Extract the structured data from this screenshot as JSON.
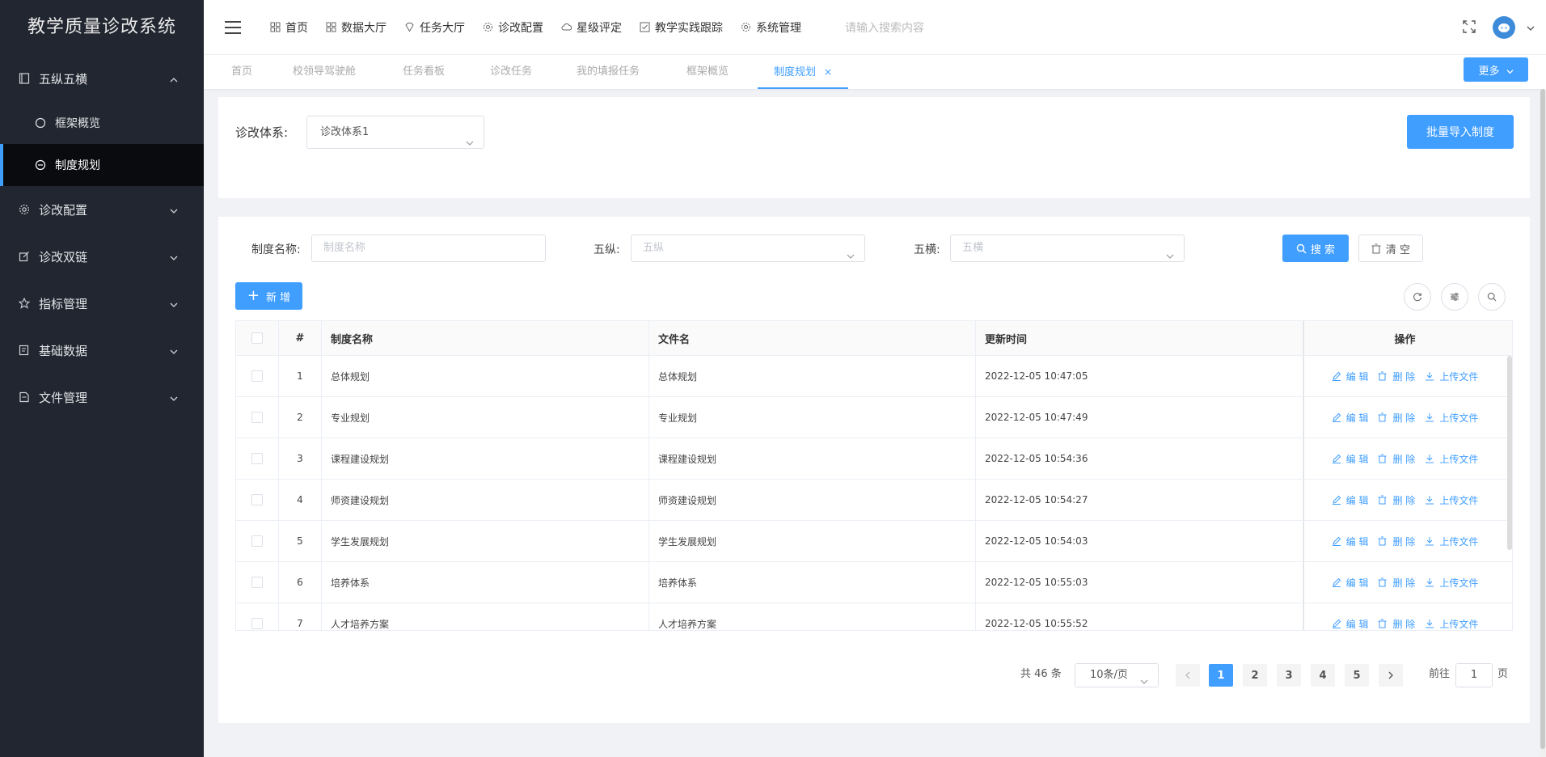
{
  "app": {
    "title": "教学质量诊改系统"
  },
  "sidebar": {
    "groups": [
      {
        "label": "五纵五横",
        "icon": "book-icon",
        "expanded": true,
        "children": [
          {
            "label": "框架概览",
            "icon": "chat-circle-icon"
          },
          {
            "label": "制度规划",
            "icon": "minus-circle-icon",
            "active": true
          }
        ]
      },
      {
        "label": "诊改配置",
        "icon": "gear-icon"
      },
      {
        "label": "诊改双链",
        "icon": "link-edit-icon"
      },
      {
        "label": "指标管理",
        "icon": "star-icon"
      },
      {
        "label": "基础数据",
        "icon": "edit-doc-icon"
      },
      {
        "label": "文件管理",
        "icon": "file-icon"
      }
    ]
  },
  "topnav": {
    "items": [
      "首页",
      "数据大厅",
      "任务大厅",
      "诊改配置",
      "星级评定",
      "教学实践跟踪",
      "系统管理"
    ],
    "search_placeholder": "请输入搜索内容"
  },
  "tabs": {
    "items": [
      "首页",
      "校领导驾驶舱",
      "任务看板",
      "诊改任务",
      "我的填报任务",
      "框架概览",
      "制度规划"
    ],
    "active": "制度规划",
    "close": "×",
    "more_label": "更多"
  },
  "system_filter": {
    "label": "诊改体系:",
    "value": "诊改体系1",
    "import_label": "批量导入制度"
  },
  "filters": {
    "name_label": "制度名称:",
    "name_placeholder": "制度名称",
    "zong_label": "五纵:",
    "zong_placeholder": "五纵",
    "heng_label": "五横:",
    "heng_placeholder": "五横",
    "search_label": "搜 索",
    "clear_label": "清 空",
    "add_label": "新 增"
  },
  "table": {
    "columns": [
      "#",
      "制度名称",
      "文件名",
      "更新时间",
      "操作"
    ],
    "actions": [
      "编 辑",
      "删 除",
      "上传文件"
    ],
    "rows": [
      {
        "idx": "1",
        "name": "总体规划",
        "file": "总体规划",
        "time": "2022-12-05 10:47:05"
      },
      {
        "idx": "2",
        "name": "专业规划",
        "file": "专业规划",
        "time": "2022-12-05 10:47:49"
      },
      {
        "idx": "3",
        "name": "课程建设规划",
        "file": "课程建设规划",
        "time": "2022-12-05 10:54:36"
      },
      {
        "idx": "4",
        "name": "师资建设规划",
        "file": "师资建设规划",
        "time": "2022-12-05 10:54:27"
      },
      {
        "idx": "5",
        "name": "学生发展规划",
        "file": "学生发展规划",
        "time": "2022-12-05 10:54:03"
      },
      {
        "idx": "6",
        "name": "培养体系",
        "file": "培养体系",
        "time": "2022-12-05 10:55:03"
      },
      {
        "idx": "7",
        "name": "人才培养方案",
        "file": "人才培养方案",
        "time": "2022-12-05 10:55:52"
      }
    ]
  },
  "pagination": {
    "total": "共 46 条",
    "page_size": "10条/页",
    "pages": [
      "1",
      "2",
      "3",
      "4",
      "5"
    ],
    "current": "1",
    "goto_label": "前往",
    "goto_value": "1",
    "page_suffix": "页"
  },
  "colors": {
    "primary": "#409eff",
    "sidebar_bg": "#222630",
    "sidebar_active": "#0a0b0e"
  }
}
